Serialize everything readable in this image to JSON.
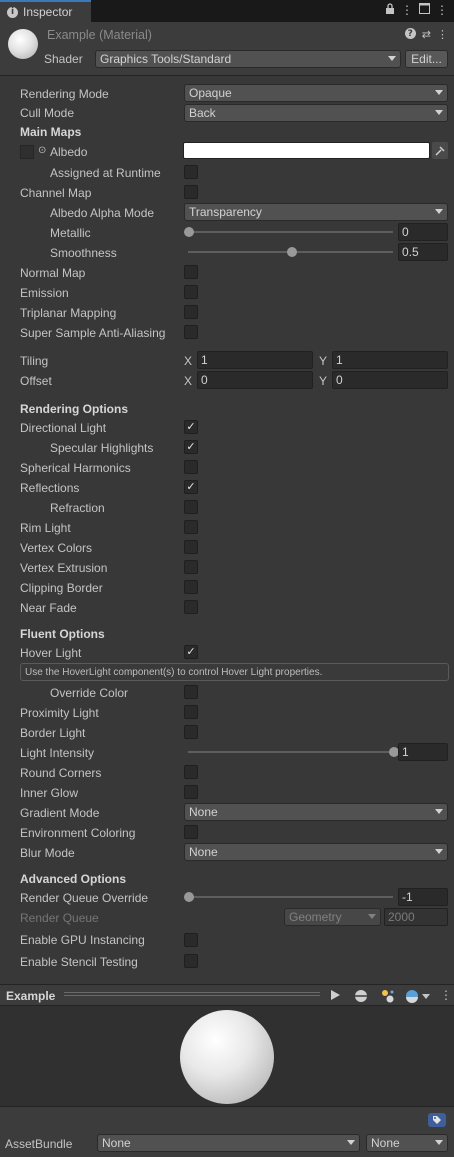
{
  "window": {
    "tab_title": "Inspector"
  },
  "header": {
    "material_name": "Example (Material)",
    "shader_label": "Shader",
    "shader_value": "Graphics Tools/Standard",
    "edit_label": "Edit..."
  },
  "rendering_mode": {
    "label": "Rendering Mode",
    "value": "Opaque"
  },
  "cull_mode": {
    "label": "Cull Mode",
    "value": "Back"
  },
  "main_maps": {
    "title": "Main Maps",
    "albedo_label": "Albedo",
    "albedo_color": "#ffffff",
    "assigned_at_runtime_label": "Assigned at Runtime",
    "channel_map_label": "Channel Map",
    "albedo_alpha_mode_label": "Albedo Alpha Mode",
    "albedo_alpha_mode_value": "Transparency",
    "metallic_label": "Metallic",
    "metallic_value": "0",
    "metallic_fraction": 0,
    "smoothness_label": "Smoothness",
    "smoothness_value": "0.5",
    "smoothness_fraction": 0.5,
    "normal_map_label": "Normal Map",
    "emission_label": "Emission",
    "triplanar_label": "Triplanar Mapping",
    "ssaa_label": "Super Sample Anti-Aliasing",
    "tiling_label": "Tiling",
    "tiling_x": "1",
    "tiling_y": "1",
    "offset_label": "Offset",
    "offset_x": "0",
    "offset_y": "0",
    "x_label": "X",
    "y_label": "Y"
  },
  "rendering_options": {
    "title": "Rendering Options",
    "directional_light": "Directional Light",
    "specular_highlights": "Specular Highlights",
    "spherical_harmonics": "Spherical Harmonics",
    "reflections": "Reflections",
    "refraction": "Refraction",
    "rim_light": "Rim Light",
    "vertex_colors": "Vertex Colors",
    "vertex_extrusion": "Vertex Extrusion",
    "clipping_border": "Clipping Border",
    "near_fade": "Near Fade"
  },
  "fluent_options": {
    "title": "Fluent Options",
    "hover_light": "Hover Light",
    "hover_info": "Use the HoverLight component(s) to control Hover Light properties.",
    "override_color": "Override Color",
    "proximity_light": "Proximity Light",
    "border_light": "Border Light",
    "light_intensity_label": "Light Intensity",
    "light_intensity_value": "1",
    "light_intensity_fraction": 1,
    "round_corners": "Round Corners",
    "inner_glow": "Inner Glow",
    "gradient_mode_label": "Gradient Mode",
    "gradient_mode_value": "None",
    "environment_coloring": "Environment Coloring",
    "blur_mode_label": "Blur Mode",
    "blur_mode_value": "None"
  },
  "advanced_options": {
    "title": "Advanced Options",
    "render_queue_override_label": "Render Queue Override",
    "render_queue_override_value": "-1",
    "render_queue_override_fraction": 0,
    "render_queue_label": "Render Queue",
    "render_queue_mode": "Geometry",
    "render_queue_value": "2000",
    "gpu_instancing": "Enable GPU Instancing",
    "stencil_testing": "Enable Stencil Testing"
  },
  "preview": {
    "title": "Example"
  },
  "asset_bundle": {
    "label": "AssetBundle",
    "name_value": "None",
    "variant_value": "None"
  }
}
